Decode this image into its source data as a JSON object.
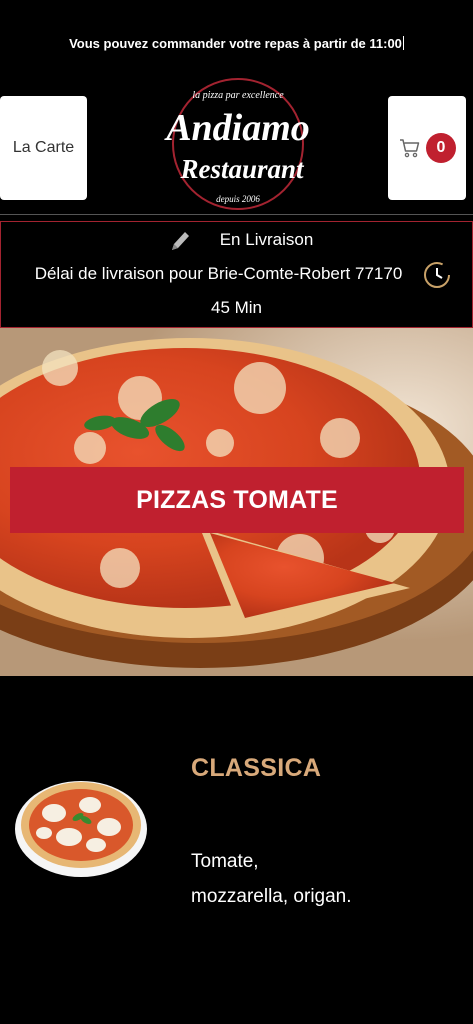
{
  "banner": {
    "text": "Vous pouvez commander votre repas à partir de 11:00"
  },
  "header": {
    "menu_label": "La Carte",
    "cart_count": "0",
    "logo": {
      "tagline": "la pizza par excellence",
      "name": "Andiamo",
      "subname": "Restaurant",
      "since": "depuis 2006"
    }
  },
  "delivery": {
    "mode": "En Livraison",
    "delay_text": "Délai de livraison pour Brie-Comte-Robert 77170",
    "duration": "45 Min"
  },
  "category": {
    "title": "PIZZAS TOMATE"
  },
  "product": {
    "name": "CLASSICA",
    "description_line1": "Tomate,",
    "description_line2": "mozzarella, origan."
  },
  "colors": {
    "accent": "#c0202f",
    "product_name": "#d8a97a"
  },
  "icons": [
    "pencil-icon",
    "cart-icon",
    "clock-icon"
  ]
}
